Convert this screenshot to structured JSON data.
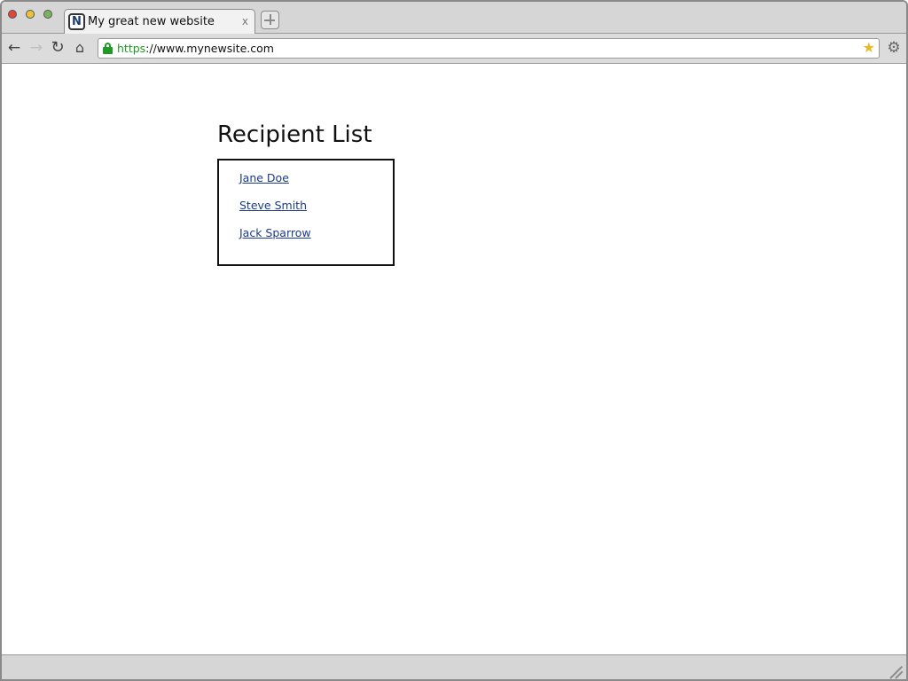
{
  "browser": {
    "tab": {
      "favicon_letter": "N",
      "title": "My great new website",
      "close_label": "x"
    },
    "toolbar": {
      "back_label": "←",
      "forward_label": "→",
      "reload_label": "↻",
      "home_label": "⌂",
      "settings_label": "⚙"
    },
    "address": {
      "scheme": "https",
      "rest": "://www.mynewsite.com",
      "star_label": "★"
    },
    "colors": {
      "secure": "#1f9a26",
      "link": "#1b3a8a",
      "star": "#e8b923"
    }
  },
  "page": {
    "heading": "Recipient List",
    "recipients": [
      {
        "label": "Jane Doe"
      },
      {
        "label": "Steve Smith"
      },
      {
        "label": "Jack Sparrow"
      }
    ]
  }
}
